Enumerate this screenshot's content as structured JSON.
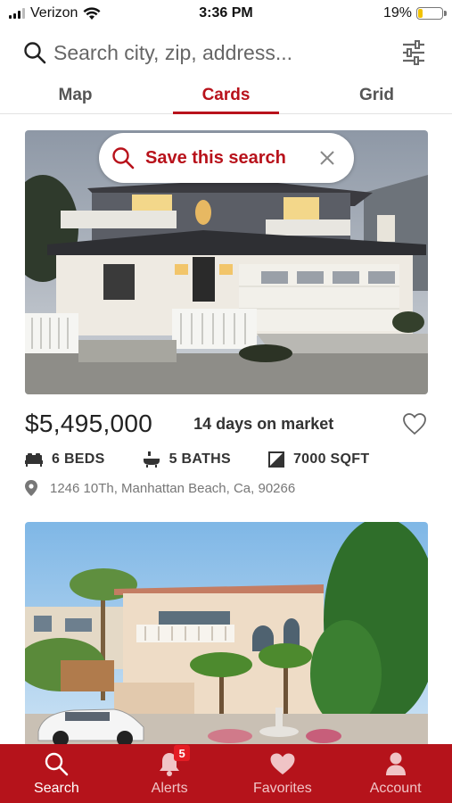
{
  "status_bar": {
    "carrier": "Verizon",
    "time": "3:36 PM",
    "battery_percent": "19%",
    "battery_level": 0.19
  },
  "search": {
    "placeholder": "Search city, zip, address..."
  },
  "tabs": [
    {
      "label": "Map",
      "active": false
    },
    {
      "label": "Cards",
      "active": true
    },
    {
      "label": "Grid",
      "active": false
    }
  ],
  "save_search": {
    "label": "Save this search"
  },
  "listings": [
    {
      "price": "$5,495,000",
      "days_on_market": "14 days on market",
      "beds": "6 BEDS",
      "baths": "5 BATHS",
      "sqft": "7000 SQFT",
      "address": "1246 10Th, Manhattan Beach, Ca, 90266"
    }
  ],
  "bottom_nav": [
    {
      "label": "Search",
      "icon": "search-icon",
      "active": true
    },
    {
      "label": "Alerts",
      "icon": "bell-icon",
      "badge": "5",
      "active": false
    },
    {
      "label": "Favorites",
      "icon": "heart-icon",
      "active": false
    },
    {
      "label": "Account",
      "icon": "person-icon",
      "active": false
    }
  ],
  "colors": {
    "brand_red": "#b8121b",
    "nav_red": "#b5131b",
    "badge_red": "#e41c24"
  }
}
